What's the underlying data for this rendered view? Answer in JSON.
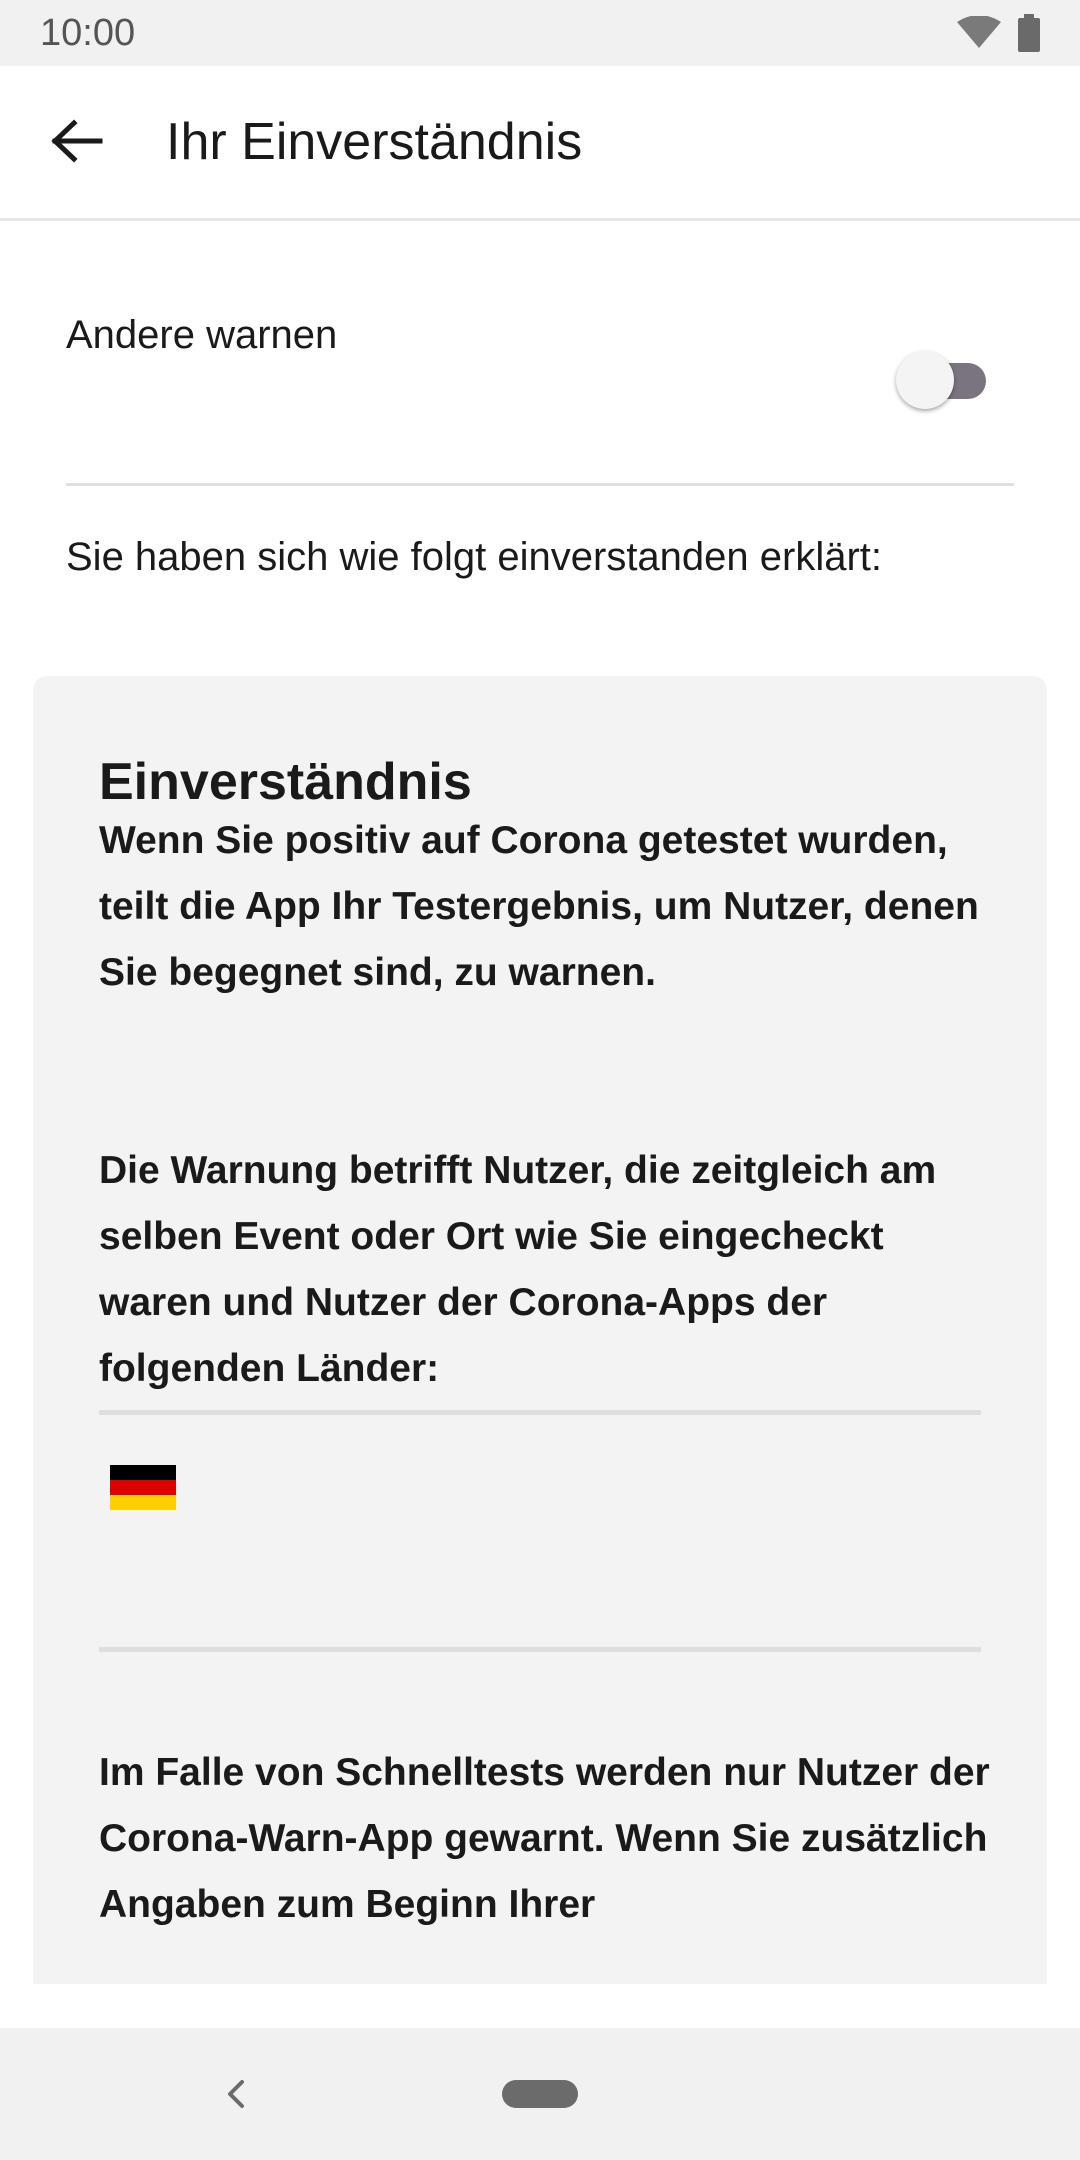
{
  "status_bar": {
    "time": "10:00",
    "icons": [
      "wifi-icon",
      "battery-icon"
    ]
  },
  "app_bar": {
    "back_icon": "arrow-left-icon",
    "title": "Ihr Einverständnis"
  },
  "consent_toggle": {
    "label": "Andere warnen",
    "enabled": false
  },
  "intro_text": "Sie haben sich wie folgt einverstanden erklärt:",
  "card": {
    "title": "Einverständnis",
    "paragraph_1": "Wenn Sie positiv auf Corona getestet wurden, teilt die App Ihr Testergebnis, um Nutzer, denen Sie begegnet sind, zu warnen.",
    "paragraph_2": "Die Warnung betrifft Nutzer, die zeitgleich am selben Event oder Ort wie Sie eingecheckt waren und Nutzer der Corona-Apps der folgenden Länder:",
    "countries": [
      {
        "flag_icon": "germany-flag-icon",
        "colors": [
          "#000000",
          "#dd0000",
          "#ffce00"
        ]
      }
    ],
    "paragraph_3": "Im Falle von Schnelltests werden nur Nutzer der Corona-Warn-App gewarnt. Wenn Sie zusätzlich Angaben zum Beginn Ihrer"
  },
  "nav_bar": {
    "back_icon": "nav-back-chevron-icon",
    "home_icon": "home-pill-icon"
  },
  "colors": {
    "status_bar_bg": "#f1f1f1",
    "card_bg": "#f3f3f3",
    "toggle_track": "#7a7480",
    "text_primary": "#1a1a1a"
  }
}
